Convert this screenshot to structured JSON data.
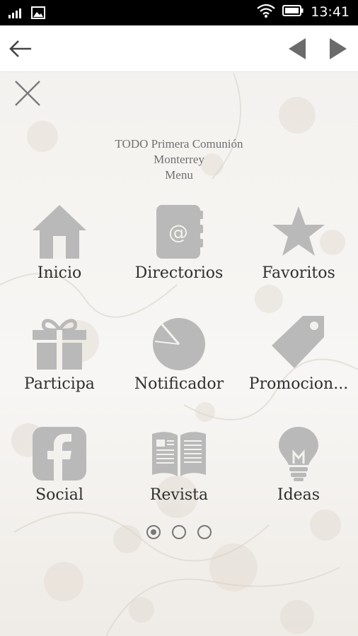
{
  "status_bar": {
    "time": "13:41",
    "icons": [
      "signal-icon",
      "image-icon",
      "wifi-icon",
      "battery-icon"
    ]
  },
  "toolbar": {
    "back_icon": "back-arrow-icon",
    "prev_icon": "triangle-left-icon",
    "next_icon": "triangle-right-icon"
  },
  "menu": {
    "close_icon": "close-icon",
    "title_line1": "TODO  Primera Comunión",
    "title_line2": "Monterrey",
    "title_line3": "Menu",
    "items": [
      {
        "label": "Inicio",
        "icon": "home-icon"
      },
      {
        "label": "Directorios",
        "icon": "address-book-icon"
      },
      {
        "label": "Favoritos",
        "icon": "star-icon"
      },
      {
        "label": "Participa",
        "icon": "gift-icon"
      },
      {
        "label": "Notificador",
        "icon": "timer-icon"
      },
      {
        "label": "Promocion...",
        "icon": "tag-icon"
      },
      {
        "label": "Social",
        "icon": "facebook-icon"
      },
      {
        "label": "Revista",
        "icon": "magazine-icon"
      },
      {
        "label": "Ideas",
        "icon": "lightbulb-icon"
      }
    ],
    "pages": 3,
    "current_page": 1
  },
  "colors": {
    "icon_gray": "#b9b9b9",
    "label_text": "#2f2f2f",
    "status_bar_bg": "#000000",
    "toolbar_bg": "#ffffff"
  }
}
